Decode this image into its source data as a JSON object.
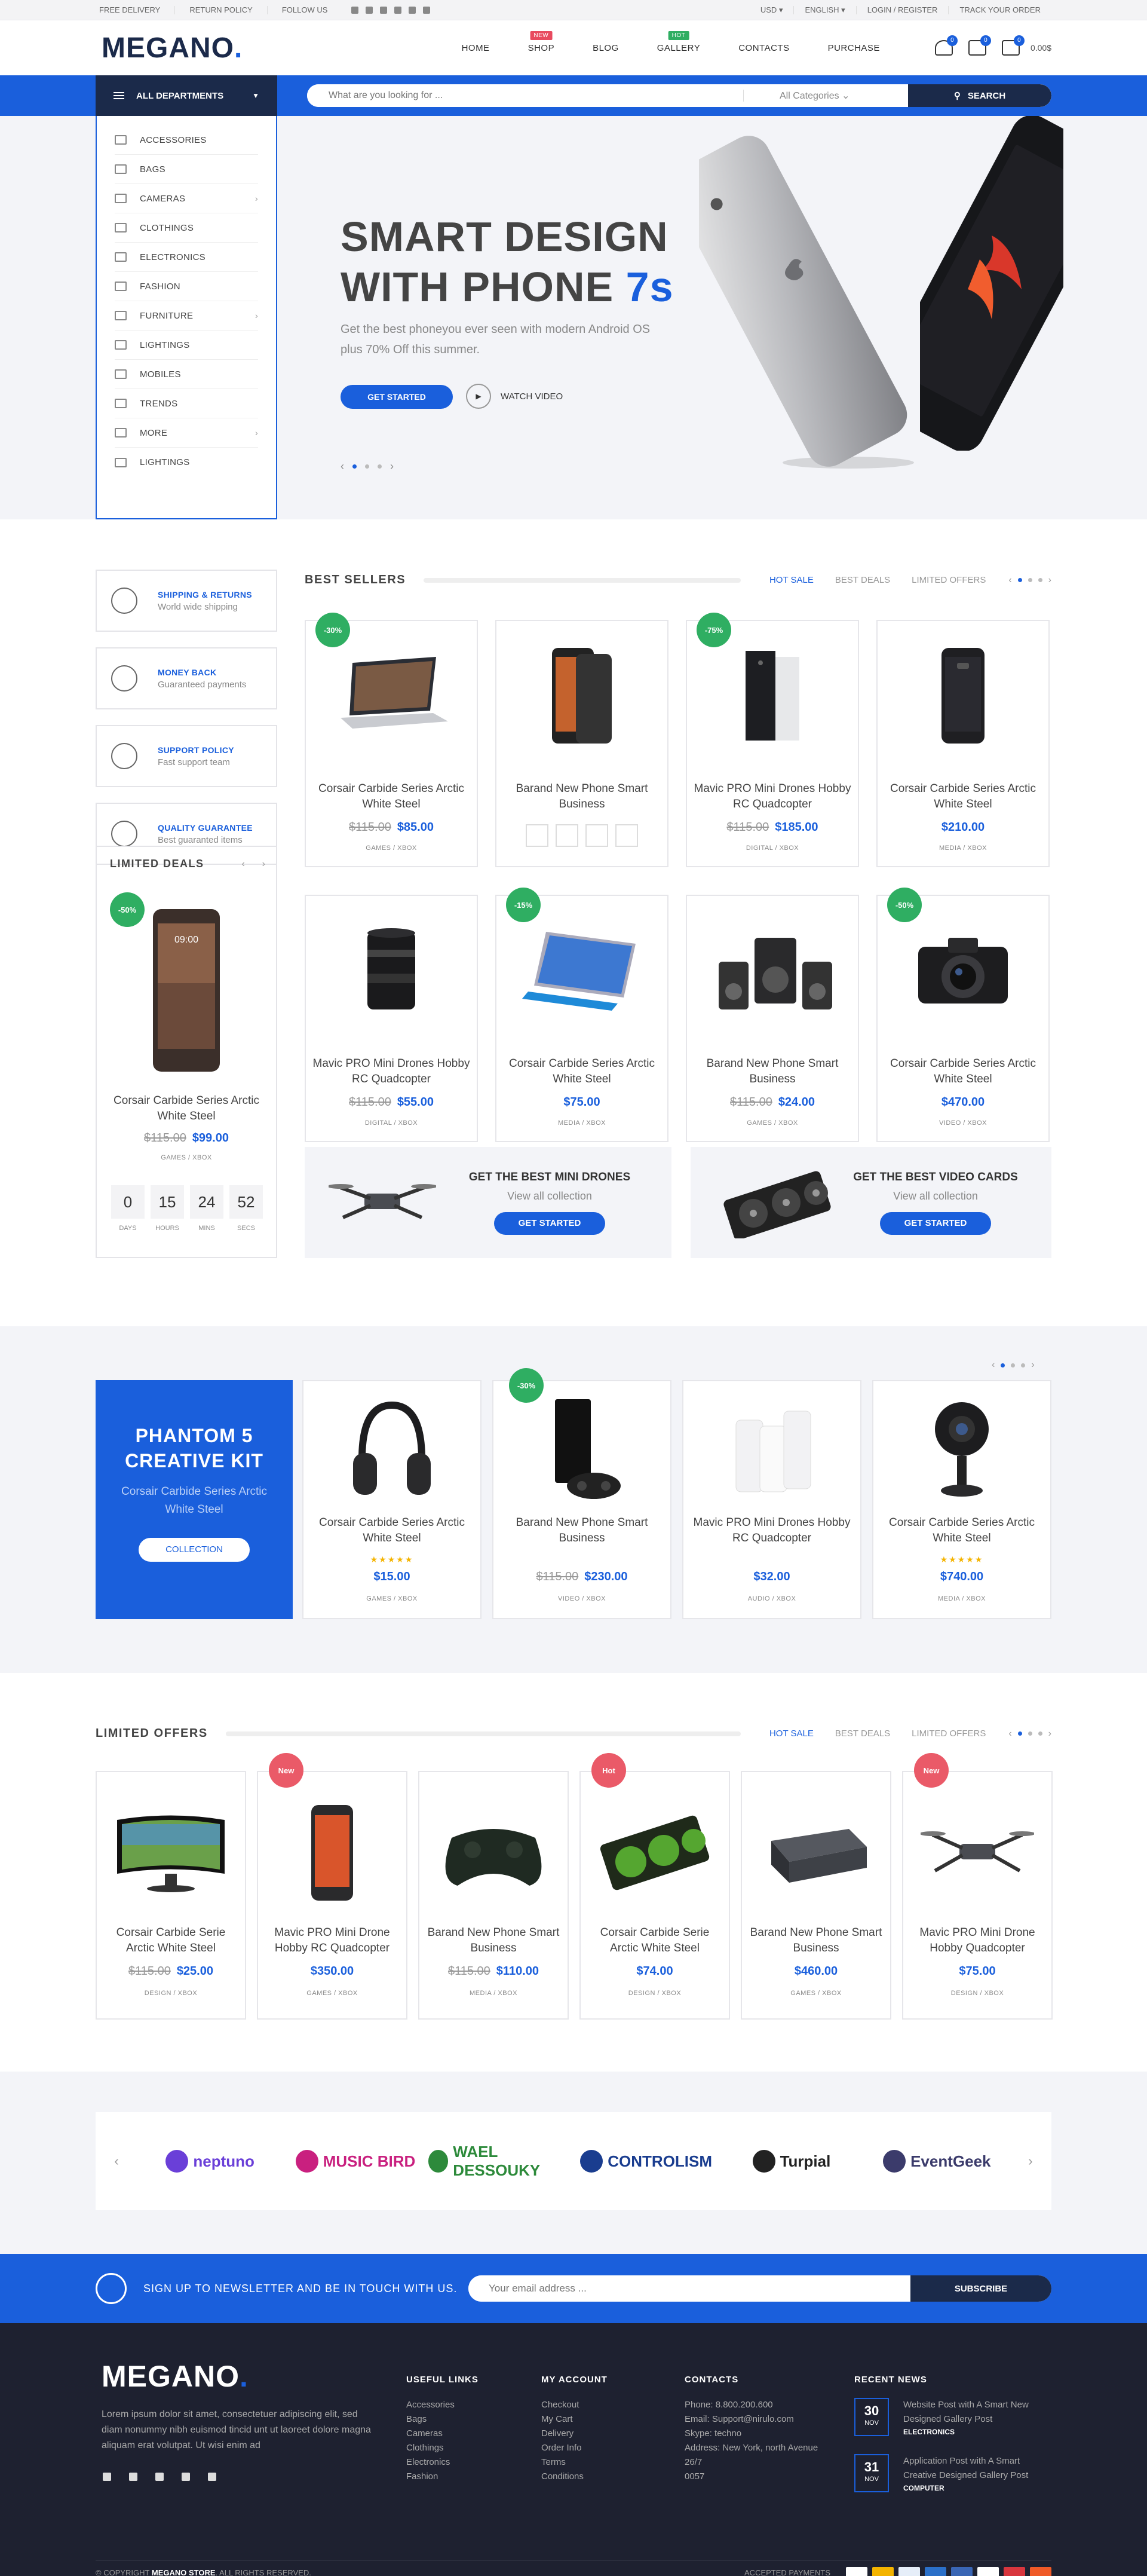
{
  "topbar": {
    "left": [
      "Free Delivery",
      "Return Policy",
      "Follow Us"
    ],
    "social_icons": [
      "facebook-icon",
      "twitter-icon",
      "youtube-icon",
      "linkedin-icon",
      "pinterest-icon",
      "mail-icon"
    ],
    "currency": "USD",
    "language": "English",
    "login": "Login / Register",
    "track": "Track Your Order"
  },
  "header": {
    "logo_text": "MEGANO",
    "logo_dot": ".",
    "nav": [
      {
        "label": "Home",
        "badge": ""
      },
      {
        "label": "Shop",
        "badge": "NEW",
        "badge_color": "#e84a5f"
      },
      {
        "label": "Blog",
        "badge": ""
      },
      {
        "label": "Gallery",
        "badge": "HOT",
        "badge_color": "#2fae62"
      },
      {
        "label": "Contacts",
        "badge": ""
      },
      {
        "label": "Purchase",
        "badge": ""
      }
    ],
    "wishlist_count": "0",
    "compare_count": "0",
    "cart_count": "0",
    "cart_total": "0.00$"
  },
  "search": {
    "departments_label": "All Departments",
    "placeholder": "What are you looking for ...",
    "category": "All Categories",
    "button": "Search"
  },
  "departments": [
    "Accessories",
    "Bags",
    "Cameras",
    "Clothings",
    "Electronics",
    "Fashion",
    "Furniture",
    "Lightings",
    "Mobiles",
    "Trends",
    "More",
    "Lightings"
  ],
  "hero": {
    "title_line1": "SMART DESIGN",
    "title_line2": "WITH PHONE ",
    "title_accent": "7s",
    "desc": "Get the best phoneyou ever seen with modern Android OS plus 70% Off this summer.",
    "cta": "Get Started",
    "video": "Watch Video"
  },
  "features": [
    {
      "title": "Shipping & Returns",
      "sub": "World wide shipping",
      "icon": "rocket-icon"
    },
    {
      "title": "Money Back",
      "sub": "Guaranteed payments",
      "icon": "money-bag-icon"
    },
    {
      "title": "Support Policy",
      "sub": "Fast support team",
      "icon": "support-icon"
    },
    {
      "title": "Quality Guarantee",
      "sub": "Best guaranted items",
      "icon": "shopping-bag-icon"
    }
  ],
  "limited_deals": {
    "title": "Limited Deals",
    "discount": "-50%",
    "name": "Corsair Carbide Series Arctic White Steel",
    "old": "$115.00",
    "price": "$99.00",
    "cat": "Games / Xbox",
    "countdown": [
      {
        "n": "0",
        "l": "Days"
      },
      {
        "n": "15",
        "l": "Hours"
      },
      {
        "n": "24",
        "l": "Mins"
      },
      {
        "n": "52",
        "l": "Secs"
      }
    ]
  },
  "best_sellers": {
    "title": "Best Sellers",
    "tabs": [
      "Hot Sale",
      "Best Deals",
      "Limited Offers"
    ],
    "products": [
      {
        "name": "Corsair Carbide Series Arctic White Steel",
        "old": "$115.00",
        "price": "$85.00",
        "cat": "Games / Xbox",
        "disc": "-30%"
      },
      {
        "name": "Barand New Phone Smart Business",
        "old": "",
        "price": "",
        "cat": "",
        "disc": ""
      },
      {
        "name": "Mavic PRO Mini Drones Hobby RC Quadcopter",
        "old": "$115.00",
        "price": "$185.00",
        "cat": "Digital / Xbox",
        "disc": "-75%"
      },
      {
        "name": "Corsair Carbide Series Arctic White Steel",
        "old": "",
        "price": "$210.00",
        "cat": "Media / Xbox",
        "disc": ""
      },
      {
        "name": "Mavic PRO Mini Drones Hobby RC Quadcopter",
        "old": "$115.00",
        "price": "$55.00",
        "cat": "Digital / Xbox",
        "disc": ""
      },
      {
        "name": "Corsair Carbide Series Arctic White Steel",
        "old": "",
        "price": "$75.00",
        "cat": "Media / Xbox",
        "disc": "-15%"
      },
      {
        "name": "Barand New Phone Smart Business",
        "old": "$115.00",
        "price": "$24.00",
        "cat": "Games / Xbox",
        "disc": ""
      },
      {
        "name": "Corsair Carbide Series Arctic White Steel",
        "old": "",
        "price": "$470.00",
        "cat": "Video / Xbox",
        "disc": "-50%"
      }
    ]
  },
  "promos": [
    {
      "title": "Get the best mini drones",
      "sub": "View all collection",
      "btn": "Get Started"
    },
    {
      "title": "Get the best video cards",
      "sub": "View all collection",
      "btn": "Get Started"
    }
  ],
  "phantom": {
    "title": "Phantom 5 Creative Kit",
    "sub": "Corsair Carbide Series Arctic White Steel",
    "btn": "Collection"
  },
  "sec3_products": [
    {
      "name": "Corsair Carbide Series Arctic White Steel",
      "old": "",
      "price": "$15.00",
      "cat": "Games / Xbox",
      "disc": "",
      "rating": 5
    },
    {
      "name": "Barand New Phone Smart Business",
      "old": "$115.00",
      "price": "$230.00",
      "cat": "Video / Xbox",
      "disc": "-30%",
      "rating": 0
    },
    {
      "name": "Mavic PRO Mini Drones Hobby RC Quadcopter",
      "old": "",
      "price": "$32.00",
      "cat": "Audio / Xbox",
      "disc": "",
      "rating": 0
    },
    {
      "name": "Corsair Carbide Series Arctic White Steel",
      "old": "",
      "price": "$740.00",
      "cat": "Media / Xbox",
      "disc": "",
      "rating": 5
    }
  ],
  "limited_offers": {
    "title": "Limited Offers",
    "tabs": [
      "Hot Sale",
      "Best Deals",
      "Limited Offers"
    ],
    "products": [
      {
        "name": "Corsair Carbide Serie Arctic White Steel",
        "old": "$115.00",
        "price": "$25.00",
        "cat": "Design / Xbox",
        "badge": ""
      },
      {
        "name": "Mavic PRO Mini Drone Hobby RC Quadcopter",
        "old": "",
        "price": "$350.00",
        "cat": "Games / Xbox",
        "badge": "New"
      },
      {
        "name": "Barand New Phone Smart Business",
        "old": "$115.00",
        "price": "$110.00",
        "cat": "Media / Xbox",
        "badge": ""
      },
      {
        "name": "Corsair Carbide Serie Arctic White Steel",
        "old": "",
        "price": "$74.00",
        "cat": "Design / Xbox",
        "badge": "Hot"
      },
      {
        "name": "Barand New Phone Smart Business",
        "old": "",
        "price": "$460.00",
        "cat": "Games / Xbox",
        "badge": ""
      },
      {
        "name": "Mavic PRO Mini Drone Hobby Quadcopter",
        "old": "",
        "price": "$75.00",
        "cat": "Design / Xbox",
        "badge": "New"
      }
    ]
  },
  "brands": [
    {
      "name": "neptuno",
      "color": "#6a3fd8"
    },
    {
      "name": "MUSIC BIRD",
      "color": "#c9207f"
    },
    {
      "name": "WAEL DESSOUKY",
      "color": "#2d8a3b"
    },
    {
      "name": "CONTROLISM",
      "color": "#1a3d8f"
    },
    {
      "name": "Turpial",
      "color": "#222"
    },
    {
      "name": "EventGeek",
      "color": "#3b3b6b"
    }
  ],
  "newsletter": {
    "text": "Sign up to newsletter and be in touch with us.",
    "placeholder": "Your email address ...",
    "btn": "Subscribe"
  },
  "footer": {
    "logo": "MEGANO",
    "logo_dot": ".",
    "desc": "Lorem ipsum dolor sit amet, consectetuer adipiscing elit, sed diam nonummy nibh euismod tincid unt ut laoreet dolore magna aliquam erat volutpat. Ut wisi enim ad",
    "useful_title": "Useful Links",
    "useful": [
      "Accessories",
      "Bags",
      "Cameras",
      "Clothings",
      "Electronics",
      "Fashion"
    ],
    "account_title": "My Account",
    "account": [
      "Checkout",
      "My Cart",
      "Delivery",
      "Order Info",
      "Terms",
      "Conditions"
    ],
    "contacts_title": "Contacts",
    "contacts": [
      "Phone: 8.800.200.600",
      "Email: Support@nirulo.com",
      "Skype: techno",
      "Address: New York, north Avenue 26/7",
      "0057"
    ],
    "news_title": "Recent News",
    "news": [
      {
        "day": "30",
        "month": "Nov",
        "text": "Website Post with A Smart New Designed Gallery Post",
        "tag": "Electronics"
      },
      {
        "day": "31",
        "month": "Nov",
        "text": "Application Post with A Smart Creative Designed Gallery Post",
        "tag": "Computer"
      }
    ],
    "copyright_prefix": "© Copyright ",
    "copyright_brand": "Megano Store",
    "copyright_suffix": ". All Rights Reserved.",
    "accepted": "Accepted Payments"
  }
}
